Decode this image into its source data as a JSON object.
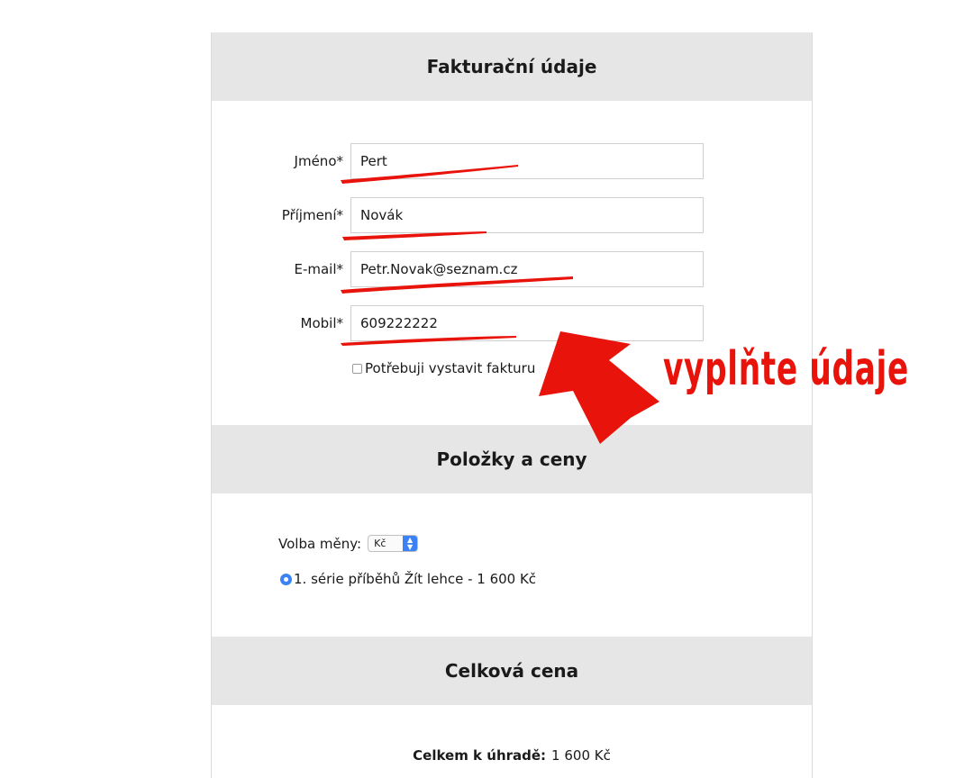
{
  "billing": {
    "title": "Fakturační údaje",
    "fields": [
      {
        "label": "Jméno*",
        "value": "Pert"
      },
      {
        "label": "Příjmení*",
        "value": "Novák"
      },
      {
        "label": "E-mail*",
        "value": "Petr.Novak@seznam.cz"
      },
      {
        "label": "Mobil*",
        "value": "609222222"
      }
    ],
    "invoice_checkbox_label": "Potřebuji vystavit fakturu"
  },
  "items": {
    "title": "Položky a ceny",
    "currency_label": "Volba měny:",
    "currency_value": "Kč",
    "option_label": "1. série příběhů Žít lehce - 1 600 Kč"
  },
  "total": {
    "title": "Celková cena",
    "label": "Celkem k úhradě:",
    "value": "1 600 Kč"
  },
  "annotation": {
    "text": "vyplňte údaje",
    "color": "#e8140c"
  }
}
